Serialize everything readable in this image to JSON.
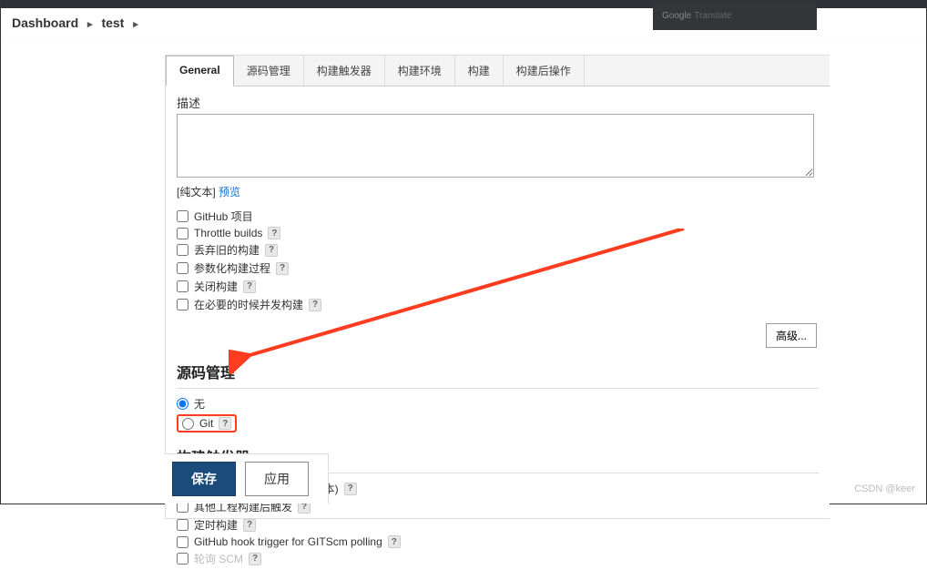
{
  "breadcrumb": {
    "root": "Dashboard",
    "item": "test"
  },
  "translate": {
    "brand": "Google",
    "product": "Translate"
  },
  "tabs": {
    "general": "General",
    "scm": "源码管理",
    "triggers": "构建触发器",
    "env": "构建环境",
    "build": "构建",
    "post": "构建后操作"
  },
  "desc_label": "描述",
  "desc_sub_prefix": "[纯文本] ",
  "desc_sub_link": "预览",
  "opts": {
    "github_project": "GitHub 项目",
    "throttle": "Throttle builds",
    "discard_old": "丢弃旧的构建",
    "parameterized": "参数化构建过程",
    "disable": "关闭构建",
    "concurrent": "在必要的时候并发构建"
  },
  "advanced": "高级...",
  "scm_section": "源码管理",
  "scm_none": "无",
  "scm_git": "Git",
  "triggers_section": "构建触发器",
  "trig": {
    "remote": "触发远程构建 (例如,使用脚本)",
    "after_other": "其他工程构建后触发",
    "periodic": "定时构建",
    "github_hook": "GitHub hook trigger for GITScm polling",
    "poll_scm": "轮询 SCM"
  },
  "save": "保存",
  "apply": "应用",
  "watermark": "CSDN @keer"
}
